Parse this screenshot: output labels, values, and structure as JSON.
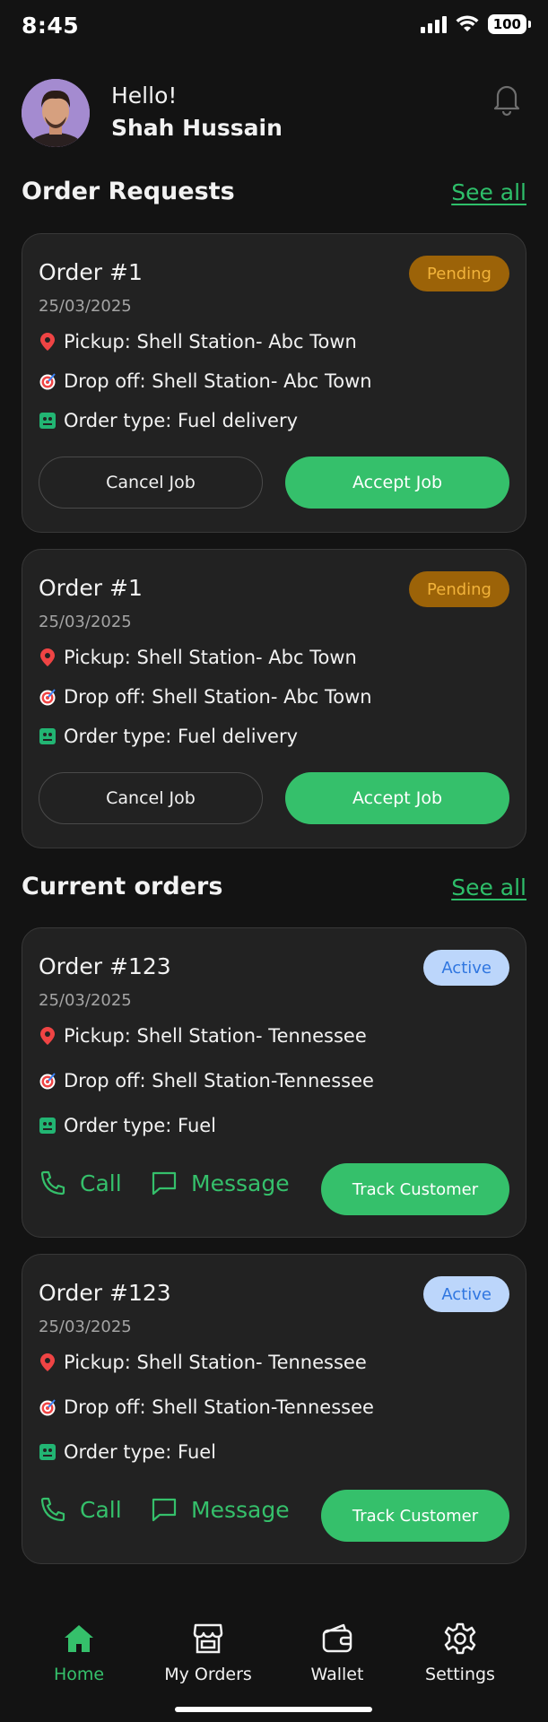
{
  "status_bar": {
    "time": "8:45",
    "battery": "100",
    "icons": [
      "signal-icon",
      "wifi-icon",
      "battery-icon"
    ]
  },
  "header": {
    "greeting": "Hello!",
    "user_name": "Shah Hussain",
    "icons": [
      "avatar",
      "bell-icon"
    ]
  },
  "order_requests": {
    "title": "Order Requests",
    "see_all": "See all",
    "cards": [
      {
        "title": "Order #1",
        "date": "25/03/2025",
        "status": "Pending",
        "pickup": "Pickup: Shell Station- Abc Town",
        "dropoff": "Drop off: Shell Station- Abc Town",
        "order_type": "Order type: Fuel delivery",
        "cancel_label": "Cancel Job",
        "accept_label": "Accept Job"
      },
      {
        "title": "Order #1",
        "date": "25/03/2025",
        "status": "Pending",
        "pickup": "Pickup: Shell Station- Abc Town",
        "dropoff": "Drop off: Shell Station- Abc Town",
        "order_type": "Order type: Fuel delivery",
        "cancel_label": "Cancel Job",
        "accept_label": "Accept Job"
      }
    ]
  },
  "current_orders": {
    "title": "Current orders",
    "see_all": "See all",
    "cards": [
      {
        "title": "Order #123",
        "date": "25/03/2025",
        "status": "Active",
        "pickup": "Pickup: Shell Station- Tennessee",
        "dropoff": "Drop off: Shell Station-Tennessee",
        "order_type": "Order type: Fuel",
        "call_label": "Call",
        "message_label": "Message",
        "track_label": "Track Customer"
      },
      {
        "title": "Order #123",
        "date": "25/03/2025",
        "status": "Active",
        "pickup": "Pickup: Shell Station- Tennessee",
        "dropoff": "Drop off: Shell Station-Tennessee",
        "order_type": "Order type: Fuel",
        "call_label": "Call",
        "message_label": "Message",
        "track_label": "Track Customer"
      }
    ]
  },
  "bottom_nav": {
    "items": [
      {
        "label": "Home",
        "icon": "home-icon",
        "active": true
      },
      {
        "label": "My Orders",
        "icon": "store-icon",
        "active": false
      },
      {
        "label": "Wallet",
        "icon": "wallet-icon",
        "active": false
      },
      {
        "label": "Settings",
        "icon": "gear-icon",
        "active": false
      }
    ]
  },
  "colors": {
    "background": "#131313",
    "card": "#222222",
    "accent_green": "#35c06b",
    "pending_bg": "#9c6308",
    "pending_text": "#f2b33a",
    "active_bg": "#bcd6fb",
    "active_text": "#2f76e0"
  }
}
